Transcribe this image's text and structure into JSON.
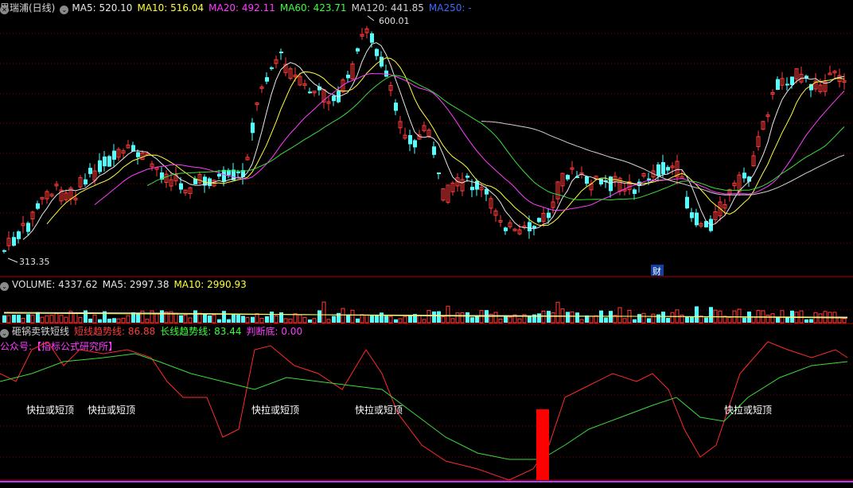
{
  "main_panel": {
    "stock_title": "思瑞浦(日线)",
    "indicators": [
      {
        "label": "MA5:",
        "value": "520.10",
        "color": "#e8e8e8"
      },
      {
        "label": "MA10:",
        "value": "516.04",
        "color": "#ffff3c"
      },
      {
        "label": "MA20:",
        "value": "492.11",
        "color": "#ff3cff"
      },
      {
        "label": "MA60:",
        "value": "423.71",
        "color": "#3cff3c"
      },
      {
        "label": "MA120:",
        "value": "441.85",
        "color": "#d0d0d0"
      },
      {
        "label": "MA250:",
        "value": "-",
        "color": "#3c6cff"
      }
    ],
    "high_label": "600.01",
    "low_label": "313.35",
    "event_marker": "财"
  },
  "volume_panel": {
    "name": "VOLUME:",
    "value": "4337.62",
    "ma5_label": "MA5:",
    "ma5_value": "2997.38",
    "ma10_label": "MA10:",
    "ma10_value": "2990.93"
  },
  "indicator_panel": {
    "name": "砸锅卖铁短线",
    "short_label": "短线趋势线:",
    "short_value": "86.88",
    "long_label": "长线趋势线:",
    "long_value": "83.44",
    "bottom_label": "判断底:",
    "bottom_value": "0.00",
    "watermark": "公众号:【指标公式研究所】",
    "top_signals": [
      "快拉或短顶",
      "快拉或短顶",
      "快拉或短顶",
      "快拉或短顶",
      "快拉或短顶"
    ],
    "bottom_signal": 1
  },
  "colors": {
    "up": "#ff3c3c",
    "down": "#54ffff",
    "short_line": "#ff2a2a",
    "long_line": "#3cdc3c",
    "bottom_bar": "#ff0000",
    "grid": "#8b0000"
  }
}
